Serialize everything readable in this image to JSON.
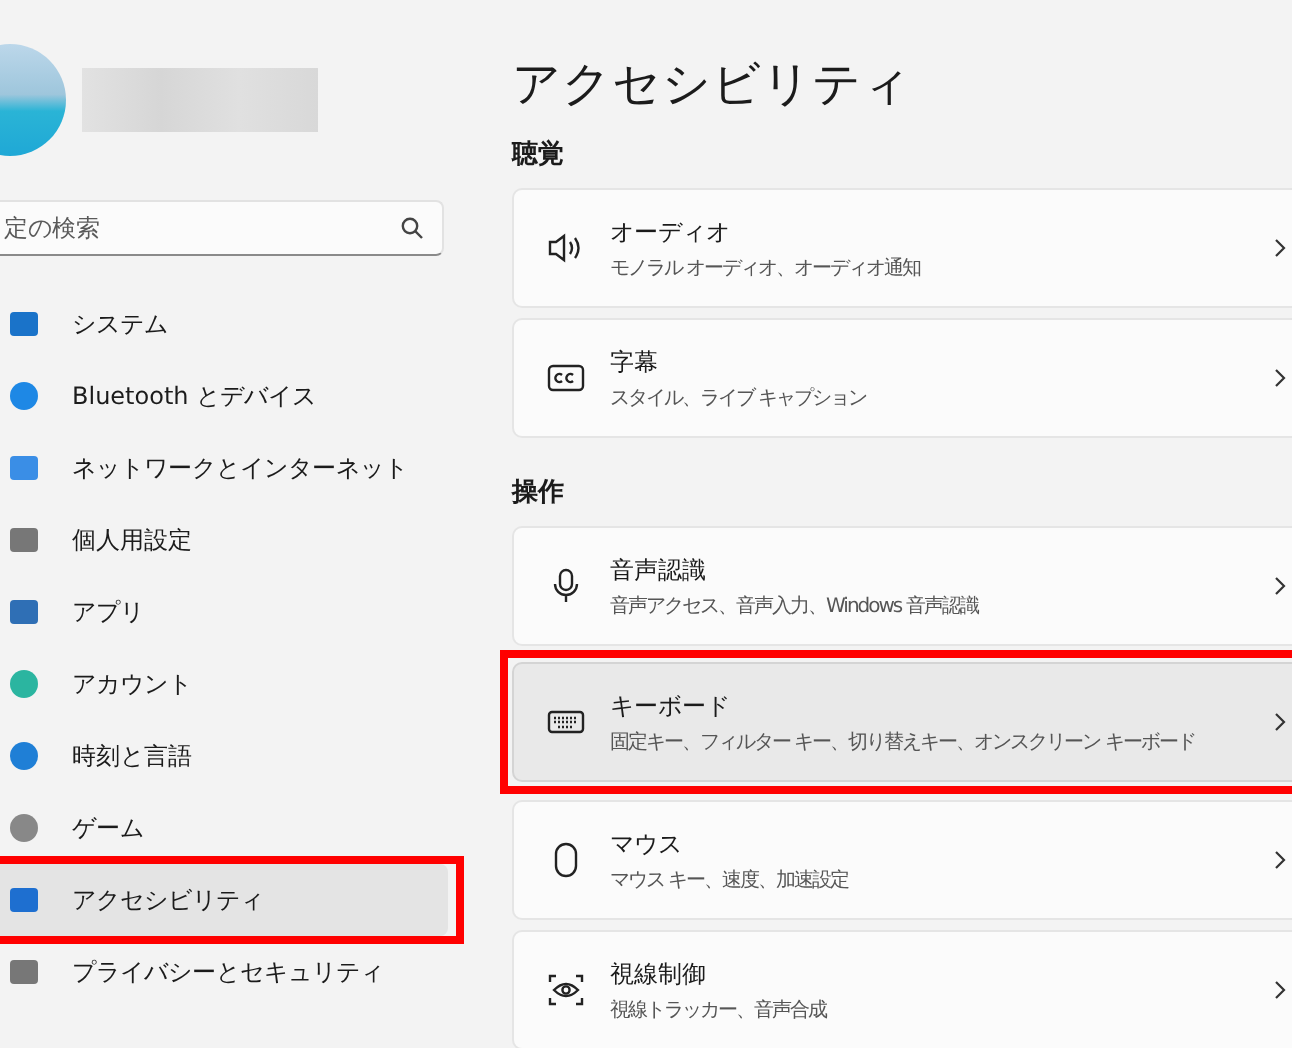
{
  "sidebar": {
    "search": {
      "placeholder": "定の検索"
    },
    "items": [
      {
        "label": "システム",
        "selected": false,
        "highlighted": false
      },
      {
        "label": "Bluetooth とデバイス",
        "selected": false,
        "highlighted": false
      },
      {
        "label": "ネットワークとインターネット",
        "selected": false,
        "highlighted": false
      },
      {
        "label": "個人用設定",
        "selected": false,
        "highlighted": false
      },
      {
        "label": "アプリ",
        "selected": false,
        "highlighted": false
      },
      {
        "label": "アカウント",
        "selected": false,
        "highlighted": false
      },
      {
        "label": "時刻と言語",
        "selected": false,
        "highlighted": false
      },
      {
        "label": "ゲーム",
        "selected": false,
        "highlighted": false
      },
      {
        "label": "アクセシビリティ",
        "selected": true,
        "highlighted": true
      },
      {
        "label": "プライバシーとセキュリティ",
        "selected": false,
        "highlighted": false
      }
    ]
  },
  "page": {
    "title": "アクセシビリティ",
    "sections": [
      {
        "heading": "聴覚",
        "cards": [
          {
            "kind": "speaker",
            "title": "オーディオ",
            "subtitle": "モノラル オーディオ、オーディオ通知",
            "highlighted": false
          },
          {
            "kind": "cc",
            "title": "字幕",
            "subtitle": "スタイル、ライブ キャプション",
            "highlighted": false
          }
        ]
      },
      {
        "heading": "操作",
        "cards": [
          {
            "kind": "mic",
            "title": "音声認識",
            "subtitle": "音声アクセス、音声入力、Windows 音声認識",
            "highlighted": false
          },
          {
            "kind": "keyboard",
            "title": "キーボード",
            "subtitle": "固定キー、フィルター キー、切り替えキー、オンスクリーン キーボード",
            "highlighted": true
          },
          {
            "kind": "mouse",
            "title": "マウス",
            "subtitle": "マウス キー、速度、加速設定",
            "highlighted": false
          },
          {
            "kind": "eye",
            "title": "視線制御",
            "subtitle": "視線トラッカー、音声合成",
            "highlighted": false
          }
        ]
      }
    ]
  }
}
